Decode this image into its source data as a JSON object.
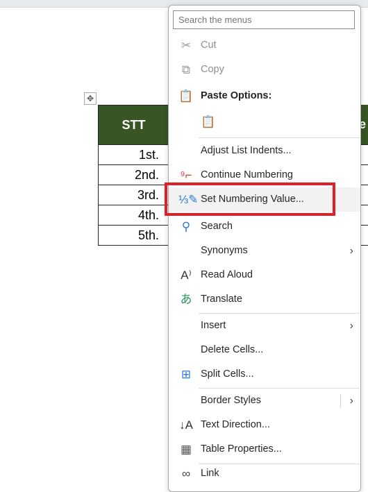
{
  "table": {
    "header": "STT",
    "header_partial": "e",
    "header_color": "#375623",
    "rows": [
      "1st.",
      "2nd.",
      "3rd.",
      "4th.",
      "5th."
    ]
  },
  "menu": {
    "search_placeholder": "Search the menus",
    "items": [
      {
        "label": "Cut",
        "key": 2,
        "icon": "scissors-icon",
        "disabled": true
      },
      {
        "label": "Copy",
        "key": 0,
        "icon": "copy-icon",
        "disabled": true
      },
      {
        "label": "Paste Options:",
        "key": -1,
        "icon": "paste-icon",
        "bold": true
      },
      {
        "label": "",
        "key": -1,
        "icon": "paste-keep-text-icon"
      },
      {
        "label": "Adjust List Indents...",
        "key": 3,
        "icon": ""
      },
      {
        "label": "Continue Numbering",
        "key": 0,
        "icon": "continue-numbering-icon"
      },
      {
        "label": "Set Numbering Value...",
        "key": 14,
        "icon": "set-numbering-value-icon",
        "highlighted": true
      },
      {
        "label": "Search",
        "key": 5,
        "icon": "search-icon"
      },
      {
        "label": "Synonyms",
        "key": 1,
        "icon": "",
        "submenu": true
      },
      {
        "label": "Read Aloud",
        "key": 0,
        "icon": "read-aloud-icon"
      },
      {
        "label": "Translate",
        "key": 4,
        "icon": "translate-icon"
      },
      {
        "label": "Insert",
        "key": 0,
        "icon": "",
        "submenu": true
      },
      {
        "label": "Delete Cells...",
        "key": 0,
        "icon": ""
      },
      {
        "label": "Split Cells...",
        "key": 1,
        "icon": "split-cells-icon"
      },
      {
        "label": "Border Styles",
        "key": 0,
        "icon": "",
        "submenu": true,
        "split": true
      },
      {
        "label": "Text Direction...",
        "key": 2,
        "icon": "text-direction-icon"
      },
      {
        "label": "Table Properties...",
        "key": 7,
        "icon": "table-properties-icon"
      },
      {
        "label": "Link",
        "key": 1,
        "icon": "link-icon"
      }
    ]
  },
  "colors": {
    "highlight_box": "#e41e26",
    "paste_icon": "#e8a33d",
    "blue_icon": "#2b7cd3"
  }
}
